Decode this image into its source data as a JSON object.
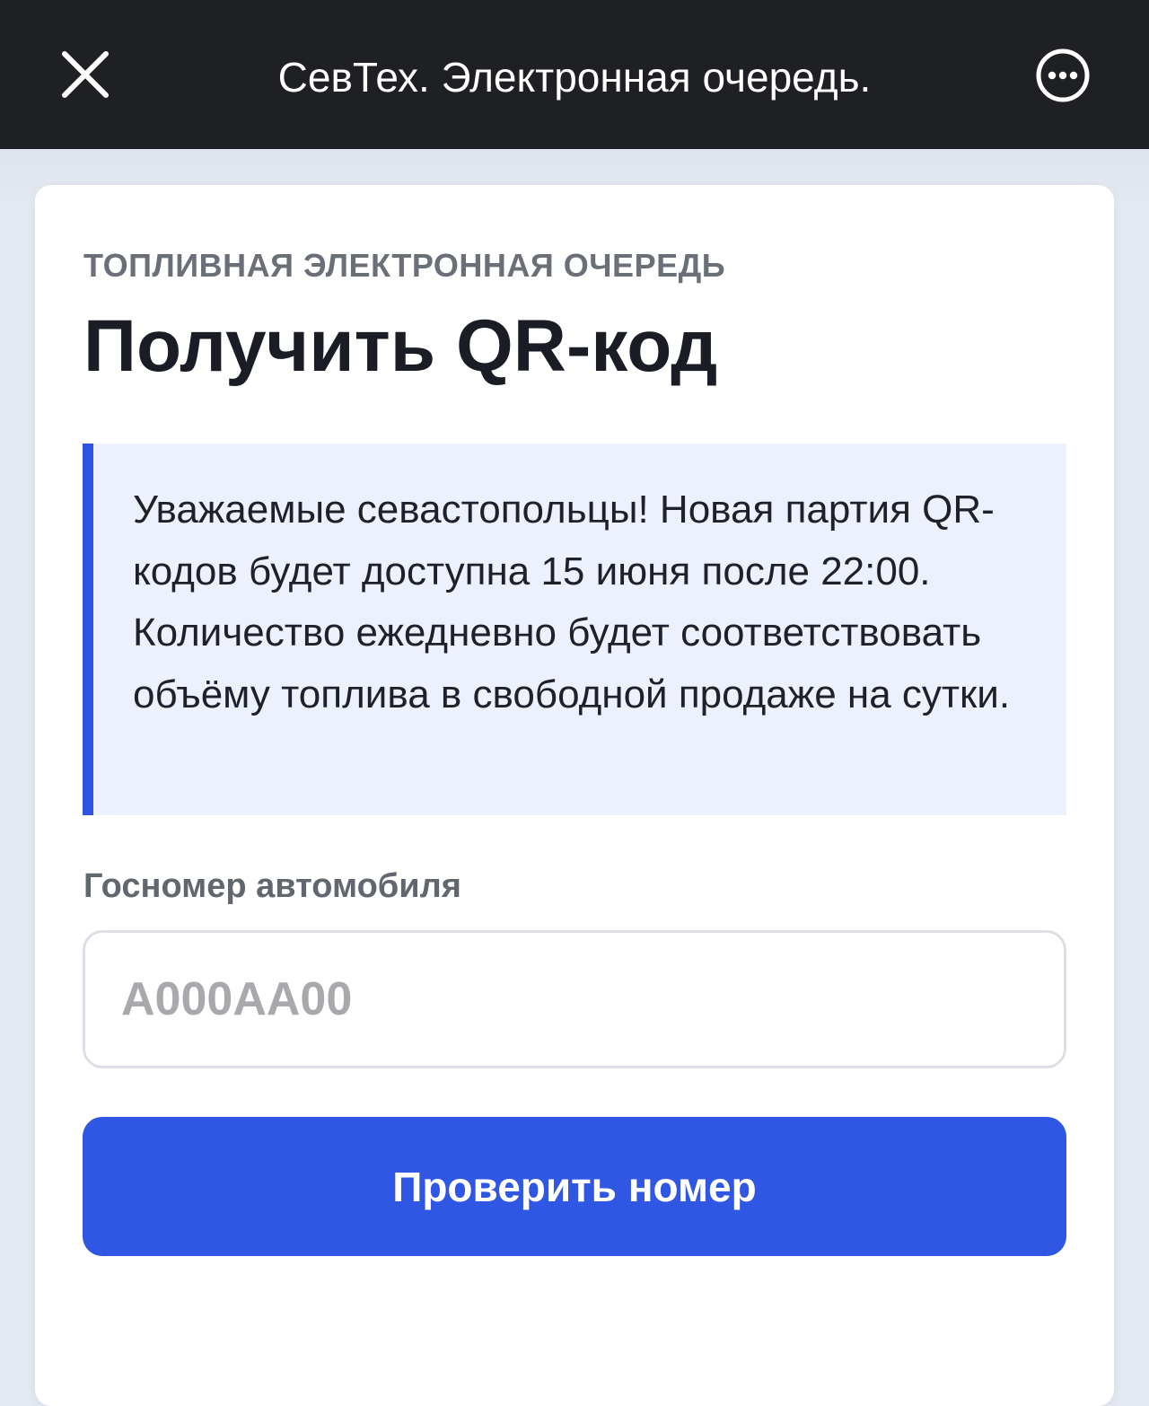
{
  "topbar": {
    "title": "СевТех. Электронная очередь.",
    "close_icon": "close-icon",
    "more_icon": "more-options-icon"
  },
  "card": {
    "eyebrow": "ТОПЛИВНАЯ ЭЛЕКТРОННАЯ ОЧЕРЕДЬ",
    "title": "Получить QR-код",
    "notice": "Уважаемые севастопольцы! Новая партия QR-кодов будет доступна 15 июня после 22:00. Количество ежедневно будет соответствовать объёму топлива в свободной продаже на сутки.",
    "plate_field": {
      "label": "Госномер автомобиля",
      "value": "",
      "placeholder": "А000АА00"
    },
    "submit_label": "Проверить номер"
  },
  "colors": {
    "topbar_bg": "#1f2023",
    "accent": "#3057e3",
    "notice_bg": "#edf1fe",
    "page_bg": "#e4e8f1"
  }
}
